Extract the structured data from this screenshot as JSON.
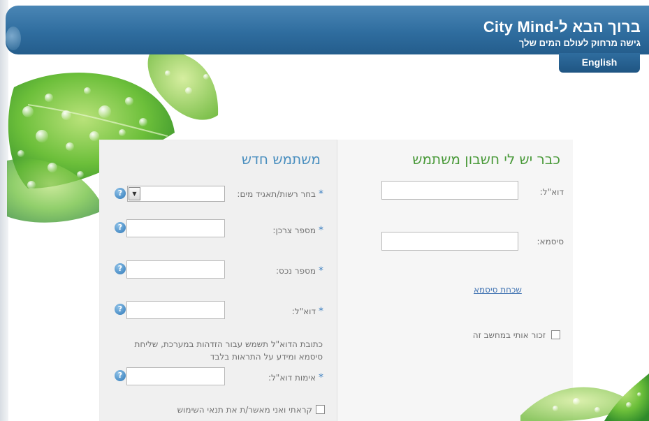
{
  "header": {
    "title": "ברוך הבא ל-City Mind",
    "subtitle": "גישה מרחוק לעולם המים שלך",
    "language_button": "English"
  },
  "existing_user": {
    "title": "כבר יש לי חשבון משתמש",
    "email_label": "דוא\"ל:",
    "email_value": "",
    "password_label": "סיסמא:",
    "password_value": "",
    "forgot_password": "שכחת סיסמא",
    "remember_me": "זכור אותי במחשב זה"
  },
  "new_user": {
    "title": "משתמש חדש",
    "authority_label": "בחר רשות/תאגיד מים:",
    "authority_value": "",
    "consumer_label": "מספר צרכן:",
    "consumer_value": "",
    "asset_label": "מספר נכס:",
    "asset_value": "",
    "email_label": "דוא\"ל:",
    "email_value": "",
    "email_note": "כתובת הדוא\"ל תשמש עבור הזדהות במערכת, שליחת סיסמא ומידע על התראות בלבד",
    "email_confirm_label": "אימות דוא\"ל:",
    "email_confirm_value": "",
    "terms_label": "קראתי ואני מאשר/ת את תנאי השימוש",
    "required_mark": "*",
    "help_glyph": "?"
  },
  "colors": {
    "header_blue": "#2f6d9f",
    "existing_title_green": "#4a9a3a",
    "new_title_blue": "#4a8fbf",
    "link_blue": "#3b6fb0"
  },
  "icons": [
    "help-icon",
    "checkbox",
    "dropdown-arrow-icon",
    "leaf-decoration"
  ]
}
